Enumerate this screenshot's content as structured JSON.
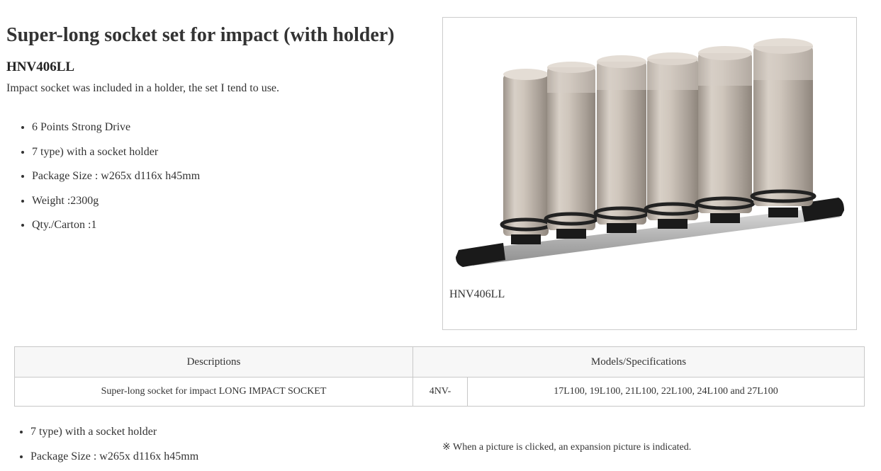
{
  "product": {
    "title": "Super-long socket set for impact (with holder)",
    "code": "HNV406LL",
    "description": "Impact socket was included in a holder, the set I tend to use.",
    "features": [
      "6 Points Strong Drive",
      "7 type) with a socket holder",
      "Package Size : w265x d116x h45mm",
      "Weight :2300g",
      "Qty./Carton :1"
    ]
  },
  "image": {
    "caption": "HNV406LL",
    "colors": {
      "socket": "#c9bfb5",
      "rail": "#b8b8b8",
      "end_caps": "#1a1a1a",
      "rings": "#222222"
    }
  },
  "table": {
    "headers": {
      "descriptions": "Descriptions",
      "models": "Models/Specifications"
    },
    "row": {
      "description": "Super-long socket for impact LONG IMPACT SOCKET",
      "prefix": "4NV-",
      "models": "17L100, 19L100, 21L100, 22L100, 24L100 and 27L100"
    }
  },
  "bottom": {
    "features": [
      "7 type) with a socket holder",
      "Package Size : w265x d116x h45mm"
    ],
    "note": "※ When a picture is clicked, an expansion picture is indicated."
  }
}
